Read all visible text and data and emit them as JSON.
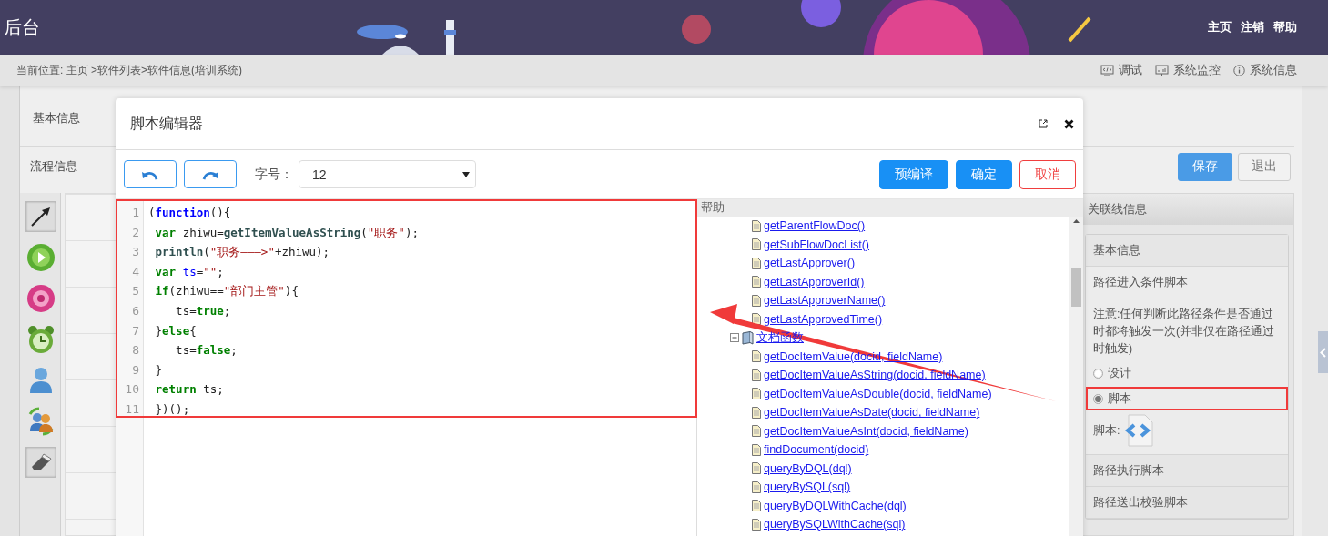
{
  "header": {
    "title": "后台",
    "nav": [
      "主页",
      "注销",
      "帮助"
    ]
  },
  "breadcrumb": {
    "text": "当前位置: 主页 >软件列表>软件信息(培训系统)",
    "tools": [
      {
        "label": "调试",
        "kind": "debug"
      },
      {
        "label": "系统监控",
        "kind": "monitor"
      },
      {
        "label": "系统信息",
        "kind": "info"
      }
    ]
  },
  "page": {
    "tabs": [
      "基本信息"
    ],
    "section_title": "流程信息",
    "buttons": [
      {
        "label": "保存",
        "kind": "primary"
      },
      {
        "label": "退出",
        "kind": "default"
      }
    ]
  },
  "modal": {
    "title": "脚本编辑器",
    "font_size": {
      "label": "字号：",
      "value": "12"
    },
    "buttons": [
      {
        "label": "预编译",
        "kind": "primary"
      },
      {
        "label": "确定",
        "kind": "primary"
      },
      {
        "label": "取消",
        "kind": "danger"
      }
    ],
    "code": [
      {
        "number": "1",
        "tokens": [
          {
            "text": "(",
            "kind": "plain"
          },
          {
            "text": "function",
            "kind": "declaration"
          },
          {
            "text": "(){",
            "kind": "plain"
          }
        ]
      },
      {
        "number": "2",
        "tokens": [
          {
            "text": " var",
            "kind": "keyword"
          },
          {
            "text": " zhiwu=",
            "kind": "plain"
          },
          {
            "text": "getItemValueAsString",
            "kind": "builtin"
          },
          {
            "text": "(",
            "kind": "plain"
          },
          {
            "text": "\"职务\"",
            "kind": "string"
          },
          {
            "text": ");",
            "kind": "plain"
          }
        ]
      },
      {
        "number": "3",
        "tokens": [
          {
            "text": " println",
            "kind": "builtin"
          },
          {
            "text": "(",
            "kind": "plain"
          },
          {
            "text": "\"职务———>\"",
            "kind": "string"
          },
          {
            "text": "+zhiwu);",
            "kind": "plain"
          }
        ]
      },
      {
        "number": "4",
        "tokens": [
          {
            "text": " var ",
            "kind": "keyword"
          },
          {
            "text": "ts",
            "kind": "variable"
          },
          {
            "text": "=",
            "kind": "plain"
          },
          {
            "text": "\"\"",
            "kind": "string"
          },
          {
            "text": ";",
            "kind": "plain"
          }
        ]
      },
      {
        "number": "5",
        "tokens": [
          {
            "text": " if",
            "kind": "keyword"
          },
          {
            "text": "(zhiwu==",
            "kind": "plain"
          },
          {
            "text": "\"部门主管\"",
            "kind": "string"
          },
          {
            "text": "){",
            "kind": "plain"
          }
        ]
      },
      {
        "number": "6",
        "tokens": [
          {
            "text": "    ts=",
            "kind": "plain"
          },
          {
            "text": "true",
            "kind": "keyword"
          },
          {
            "text": ";",
            "kind": "plain"
          }
        ]
      },
      {
        "number": "7",
        "tokens": [
          {
            "text": " }",
            "kind": "plain"
          },
          {
            "text": "else",
            "kind": "keyword"
          },
          {
            "text": "{",
            "kind": "plain"
          }
        ]
      },
      {
        "number": "8",
        "tokens": [
          {
            "text": "    ts=",
            "kind": "plain"
          },
          {
            "text": "false",
            "kind": "keyword"
          },
          {
            "text": ";",
            "kind": "plain"
          }
        ]
      },
      {
        "number": "9",
        "tokens": [
          {
            "text": " }",
            "kind": "plain"
          }
        ]
      },
      {
        "number": "10",
        "tokens": [
          {
            "text": " return",
            "kind": "keyword"
          },
          {
            "text": " ts;",
            "kind": "plain"
          }
        ]
      },
      {
        "number": "11",
        "tokens": [
          {
            "text": " })();",
            "kind": "plain"
          }
        ]
      }
    ],
    "help": {
      "title": "帮助",
      "items": [
        {
          "kind": "function",
          "label": "getParentFlowDoc()"
        },
        {
          "kind": "function",
          "label": "getSubFlowDocList()"
        },
        {
          "kind": "function",
          "label": "getLastApprover()"
        },
        {
          "kind": "function",
          "label": "getLastApproverId()"
        },
        {
          "kind": "function",
          "label": "getLastApproverName()"
        },
        {
          "kind": "function",
          "label": "getLastApprovedTime()"
        },
        {
          "kind": "folder",
          "label": "文档函数",
          "expanded": true,
          "children": [
            {
              "kind": "function",
              "label": "getDocItemValue(docid, fieldName)"
            },
            {
              "kind": "function",
              "label": "getDocItemValueAsString(docid, fieldName)"
            },
            {
              "kind": "function",
              "label": "getDocItemValueAsDouble(docid, fieldName)"
            },
            {
              "kind": "function",
              "label": "getDocItemValueAsDate(docid, fieldName)"
            },
            {
              "kind": "function",
              "label": "getDocItemValueAsInt(docid, fieldName)"
            },
            {
              "kind": "function",
              "label": "findDocument(docid)"
            },
            {
              "kind": "function",
              "label": "queryByDQL(dql)"
            },
            {
              "kind": "function",
              "label": "queryBySQL(sql)"
            },
            {
              "kind": "function",
              "label": "queryByDQLWithCache(dql)"
            },
            {
              "kind": "function",
              "label": "queryBySQLWithCache(sql)"
            }
          ]
        }
      ]
    }
  },
  "right_panel": {
    "title": "关联线信息",
    "sections": [
      {
        "label": "基本信息"
      },
      {
        "label": "路径进入条件脚本",
        "note": "注意:任何判断此路径条件是否通过时都将触发一次(并非仅在路径通过时触发)",
        "options": [
          {
            "label": "设计",
            "selected": false
          },
          {
            "label": "脚本",
            "selected": true
          }
        ],
        "script_label": "脚本:"
      },
      {
        "label": "路径执行脚本"
      },
      {
        "label": "路径送出校验脚本"
      }
    ]
  }
}
